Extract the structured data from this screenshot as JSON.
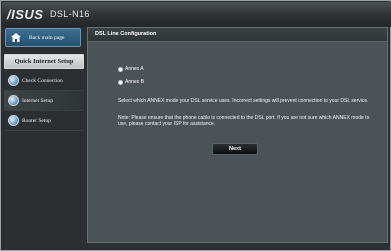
{
  "header": {
    "brand": "/ISUS",
    "model": "DSL-N16"
  },
  "sidebar": {
    "back_label": "Back main page",
    "section_title": "Quick Internet Setup",
    "items": [
      {
        "label": "Check Connection"
      },
      {
        "label": "Internet Setup"
      },
      {
        "label": "Router Setup"
      }
    ]
  },
  "main": {
    "title": "DSL Line Configuration",
    "options": [
      {
        "label": "Annex A",
        "selected": false
      },
      {
        "label": "Annex B",
        "selected": false
      }
    ],
    "desc1": "Select which ANNEX mode your DSL service uses. Incorrect settings will prevent connection to your DSL service.",
    "desc2": "Note: Please ensure that the phone cable is connected to the DSL port. If you are not sure which ANNEX mode to use, please contact your ISP for assistance.",
    "next_label": "Next"
  },
  "colors": {
    "background": "#2b2f31",
    "panel": "#4c5356",
    "accent": "#24506f"
  }
}
